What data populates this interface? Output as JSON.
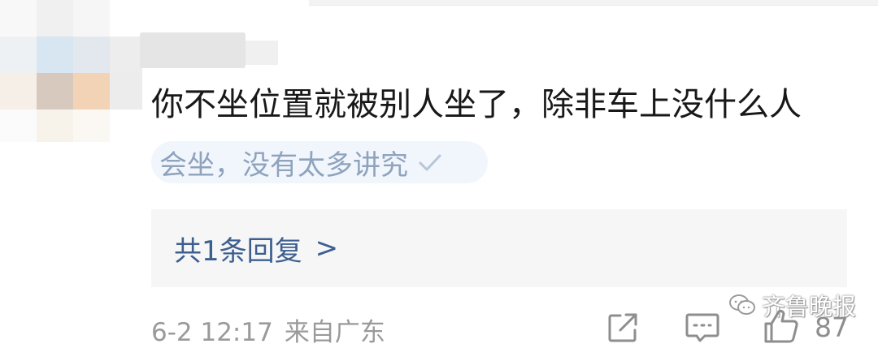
{
  "comment": {
    "text": "你不坐位置就被别人坐了，除非车上没什么人",
    "tag": "会坐，没有太多讲究"
  },
  "replies": {
    "label": "共1条回复",
    "chevron": ">"
  },
  "meta": {
    "time": "6-2 12:17",
    "location": "来自广东"
  },
  "actions": {
    "share_icon": "share-icon",
    "comment_icon": "comment-icon",
    "like_icon": "thumbs-up-icon",
    "like_count": "87"
  },
  "watermark": {
    "text": "齐鲁晚报"
  },
  "colors": {
    "link": "#3c5f90",
    "tag_bg": "#f1f6fc",
    "tag_text": "#8fa3bd",
    "meta": "#9a9a9a"
  }
}
